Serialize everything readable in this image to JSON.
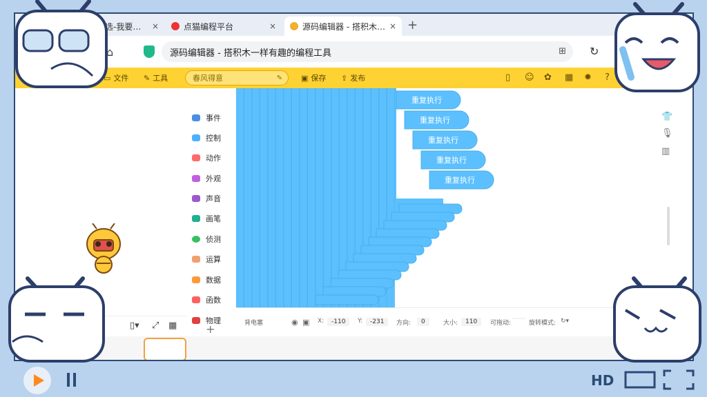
{
  "browser": {
    "tabs": [
      {
        "label": "精选-我要…",
        "favicon": "video-icon"
      },
      {
        "label": "点猫编程平台",
        "favicon": "codemao-icon"
      },
      {
        "label": "源码编辑器 - 搭积木…",
        "favicon": "editor-icon"
      }
    ],
    "new_tab": "+",
    "close_glyph": "×",
    "url": "源码编辑器 - 搭积木一样有趣的编程工具"
  },
  "toolbar": {
    "file": "文件",
    "tools": "工具",
    "project_name": "春风得意",
    "save": "保存",
    "publish": "发布"
  },
  "categories": [
    {
      "label": "事件",
      "color": "#4a90e2"
    },
    {
      "label": "控制",
      "color": "#4cb1ff"
    },
    {
      "label": "动作",
      "color": "#ff6a6a"
    },
    {
      "label": "外观",
      "color": "#c060e0"
    },
    {
      "label": "声音",
      "color": "#9b59d0"
    },
    {
      "label": "画笔",
      "color": "#20b090"
    },
    {
      "label": "侦测",
      "color": "#38c060"
    },
    {
      "label": "运算",
      "color": "#f0a070"
    },
    {
      "label": "数据",
      "color": "#ff9a3c"
    },
    {
      "label": "函数",
      "color": "#ff6060"
    },
    {
      "label": "物理",
      "color": "#e04040"
    }
  ],
  "category_add": "+",
  "blocks": {
    "loop_label": "重复执行",
    "color": "#5cc0ff"
  },
  "sprite_info": {
    "name": "背电塞",
    "x_label": "X:",
    "x": "-110",
    "y_label": "Y:",
    "y": "-231",
    "direction_label": "方向:",
    "direction": "0",
    "size_label": "大小:",
    "size": "110",
    "draggable_label": "可拖动:",
    "rotation_label": "旋转模式:"
  },
  "player": {
    "hd": "HD"
  }
}
